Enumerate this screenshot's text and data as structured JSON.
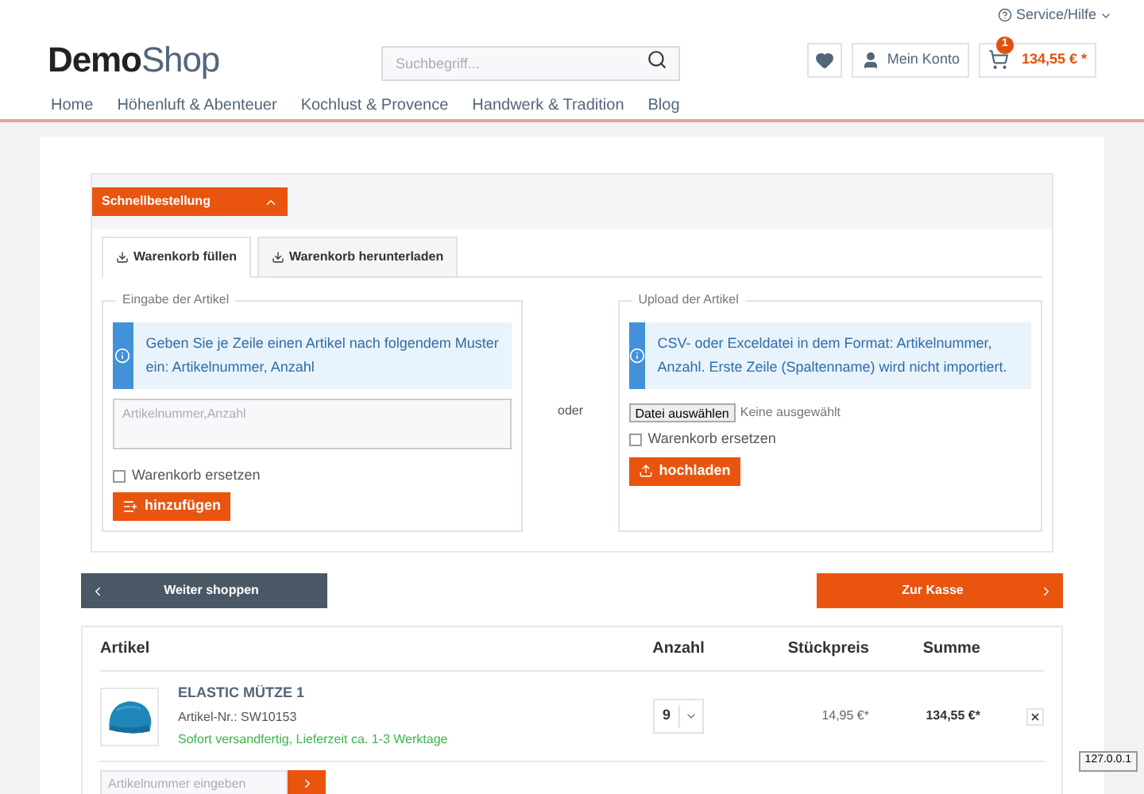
{
  "header": {
    "service_link": "Service/Hilfe",
    "logo": {
      "bold": "Demo",
      "light": "Shop"
    },
    "search": {
      "placeholder": "Suchbegriff..."
    },
    "account": "Mein Konto",
    "cart": {
      "count": "1",
      "total": "134,55 € *"
    }
  },
  "nav": [
    {
      "label": "Home",
      "selected": false
    },
    {
      "label": "Höhenluft & Abenteuer",
      "selected": false
    },
    {
      "label": "Kochlust & Provence",
      "selected": false
    },
    {
      "label": "Handwerk & Tradition",
      "selected": false
    },
    {
      "label": "Blog",
      "selected": false
    }
  ],
  "quick_order": {
    "toggle": "Schnellbestellung",
    "expanded": true,
    "tabs": [
      {
        "label": "Warenkorb füllen",
        "selected": true
      },
      {
        "label": "Warenkorb herunterladen",
        "selected": false
      }
    ],
    "entry": {
      "legend": "Eingabe der Artikel",
      "info": "Geben Sie je Zeile einen Artikel nach folgendem Muster ein: Artikelnummer, Anzahl",
      "placeholder": "Artikelnummer,Anzahl",
      "replace_label": "Warenkorb ersetzen",
      "replace_checked": false,
      "button": "hinzufügen"
    },
    "separator": "oder",
    "upload": {
      "legend": "Upload der Artikel",
      "info": "CSV- oder Exceldatei in dem Format: Artikelnummer, Anzahl. Erste Zeile (Spaltenname) wird nicht importiert.",
      "file_button": "Datei auswählen",
      "file_status": "Keine ausgewählt",
      "replace_label": "Warenkorb ersetzen",
      "replace_checked": false,
      "button": "hochladen"
    }
  },
  "actions": {
    "back": "Weiter shoppen",
    "checkout": "Zur Kasse"
  },
  "cart_table": {
    "columns": [
      "Artikel",
      "Anzahl",
      "Stückpreis",
      "Summe"
    ],
    "rows": [
      {
        "kind": "picture",
        "name": "ELASTIC MÜTZE 1",
        "sku": "Artikel-Nr.: SW10153",
        "delivery": "Sofort versandfertig, Lieferzeit ca. 1-3 Werktage",
        "quantity": "9",
        "unit_price": "14,95 €*",
        "total": "134,55 €*"
      }
    ],
    "add_placeholder": "Artikelnummer eingeben"
  },
  "status_tooltip": "127.0.0.1"
}
